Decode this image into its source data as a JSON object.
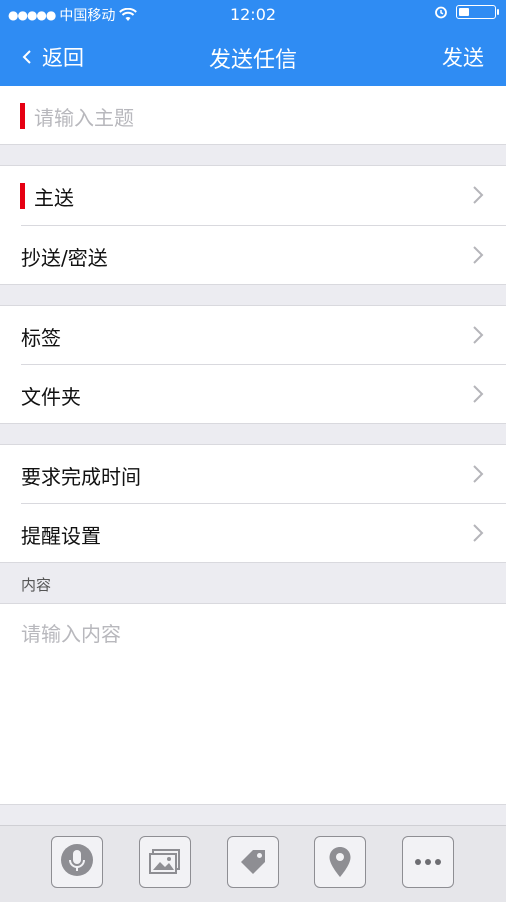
{
  "status_bar": {
    "carrier": "中国移动",
    "time": "12:02",
    "battery_level": 0.3
  },
  "nav": {
    "back_label": "返回",
    "title": "发送任信",
    "send_label": "发送"
  },
  "subject": {
    "placeholder": "请输入主题"
  },
  "rows": {
    "to": "主送",
    "cc_bcc": "抄送/密送",
    "tags": "标签",
    "folder": "文件夹",
    "due_time": "要求完成时间",
    "reminder": "提醒设置"
  },
  "content": {
    "header": "内容",
    "placeholder": "请输入内容"
  },
  "toolbar": {
    "icons": [
      "microphone-icon",
      "image-icon",
      "tag-icon",
      "location-pin-icon",
      "more-icon"
    ]
  },
  "colors": {
    "accent": "#2f8cf3",
    "required_marker": "#e60012"
  }
}
